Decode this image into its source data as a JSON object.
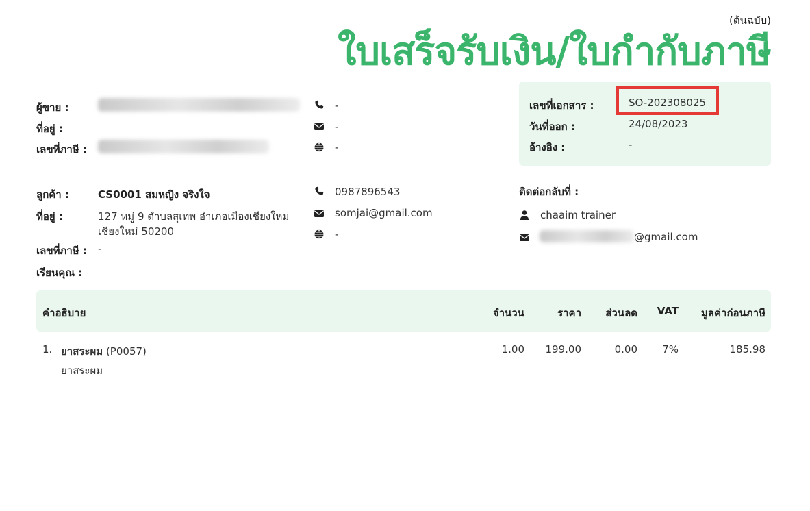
{
  "header": {
    "original_label": "(ต้นฉบับ)",
    "title": "ใบเสร็จรับเงิน/ใบกำกับภาษี"
  },
  "seller": {
    "name_label": "ผู้ขาย :",
    "address_label": "ที่อยู่ :",
    "tax_id_label": "เลขที่ภาษี :",
    "phone": "-",
    "email": "-",
    "website": "-"
  },
  "customer": {
    "name_label": "ลูกค้า :",
    "name": "CS0001 สมหญิง จริงใจ",
    "address_label": "ที่อยู่ :",
    "address_line1": "127 หมู่ 9 ตำบลสุเทพ อำเภอเมืองเชียงใหม่",
    "address_line2": "เชียงใหม่ 50200",
    "tax_id_label": "เลขที่ภาษี :",
    "tax_id": "-",
    "attention_label": "เรียนคุณ :",
    "phone": "0987896543",
    "email": "somjai@gmail.com",
    "website": "-"
  },
  "document": {
    "doc_no_label": "เลขที่เอกสาร :",
    "doc_no": "SO-202308025",
    "issue_date_label": "วันที่ออก :",
    "issue_date": "24/08/2023",
    "reference_label": "อ้างอิง :",
    "reference": "-"
  },
  "contact": {
    "label": "ติดต่อกลับที่ :",
    "name": "chaaim trainer",
    "email_suffix": "@gmail.com"
  },
  "table": {
    "headers": {
      "description": "คำอธิบาย",
      "qty": "จำนวน",
      "price": "ราคา",
      "discount": "ส่วนลด",
      "vat": "VAT",
      "pretax": "มูลค่าก่อนภาษี"
    },
    "rows": [
      {
        "index": "1.",
        "name": "ยาสระผม",
        "code": "(P0057)",
        "detail": "ยาสระผม",
        "qty": "1.00",
        "price": "199.00",
        "discount": "0.00",
        "vat": "7%",
        "pretax": "185.98"
      }
    ]
  },
  "colors": {
    "accent": "#3bb56c",
    "panel": "#eaf7ee",
    "highlight": "#e53935"
  },
  "icons": {
    "phone": "phone-icon",
    "email": "envelope-icon",
    "web": "globe-icon",
    "user": "user-icon"
  }
}
